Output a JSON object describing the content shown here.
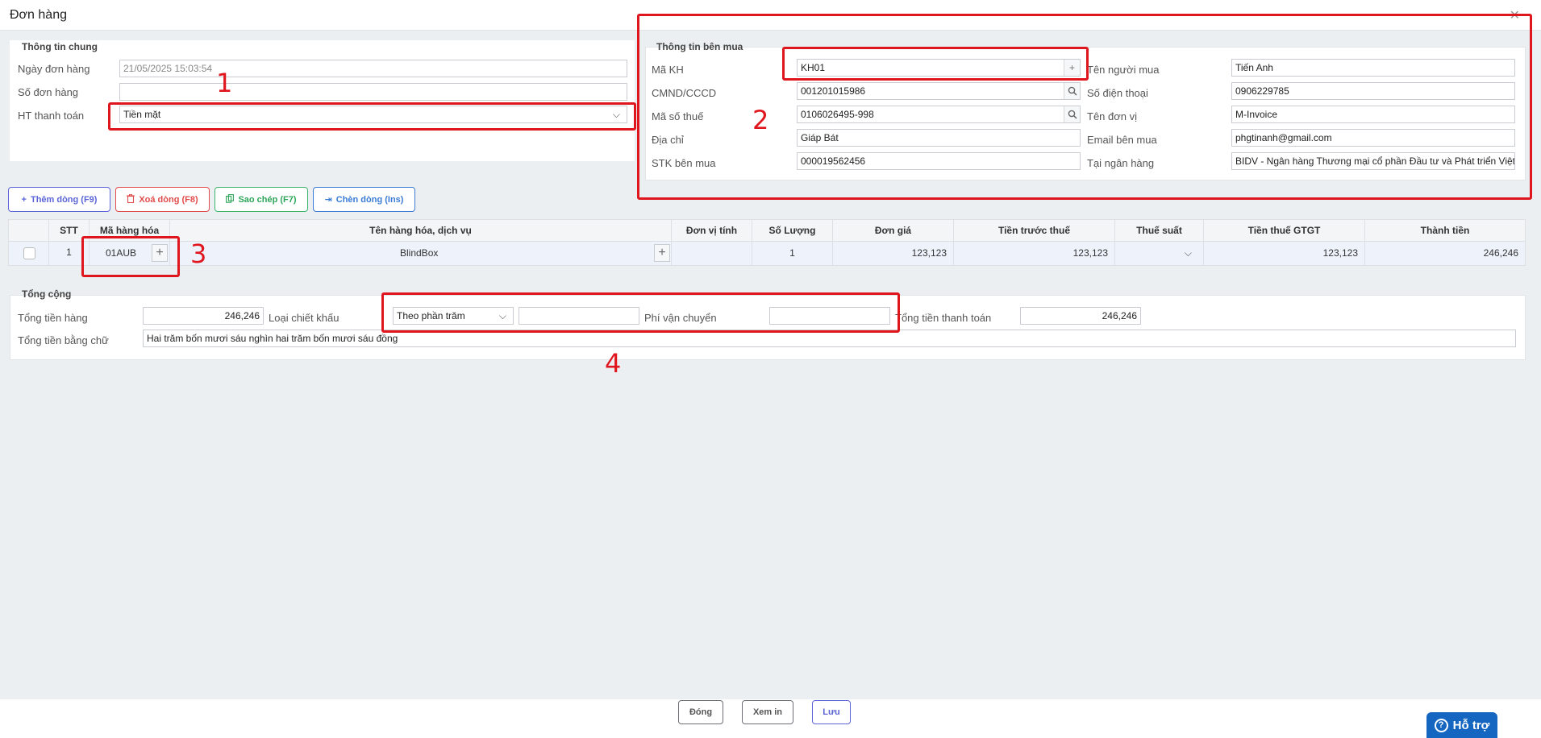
{
  "window": {
    "title": "Đơn hàng",
    "close_icon": "close-icon"
  },
  "general": {
    "title": "Thông tin chung",
    "order_date_label": "Ngày đơn hàng",
    "order_date_value": "21/05/2025 15:03:54",
    "order_no_label": "Số đơn hàng",
    "order_no_value": "",
    "payment_label": "HT thanh toán",
    "payment_value": "Tiền mặt"
  },
  "buyer": {
    "title": "Thông tin bên mua",
    "customer_code_label": "Mã KH",
    "customer_code_value": "KH01",
    "id_label": "CMND/CCCD",
    "id_value": "001201015986",
    "tax_label": "Mã số thuế",
    "tax_value": "0106026495-998",
    "address_label": "Địa chỉ",
    "address_value": "Giáp Bát",
    "account_label": "STK bên mua",
    "account_value": "000019562456",
    "buyer_name_label": "Tên người mua",
    "buyer_name_value": "Tiến Anh",
    "phone_label": "Số điện thoại",
    "phone_value": "0906229785",
    "unit_label": "Tên đơn vị",
    "unit_value": "M-Invoice",
    "email_label": "Email bên mua",
    "email_value": "phgtinanh@gmail.com",
    "bank_label": "Tại ngân hàng",
    "bank_value": "BIDV - Ngân hàng Thương mại cổ phần Đầu tư và Phát triển Việt Nam"
  },
  "toolbar": {
    "add_row": "Thêm dòng (F9)",
    "delete_row": "Xoá dòng (F8)",
    "copy": "Sao chép (F7)",
    "insert_row": "Chèn dòng (Ins)"
  },
  "table": {
    "columns": [
      "STT",
      "Mã hàng hóa",
      "Tên hàng hóa, dịch vụ",
      "Đơn vị tính",
      "Số Lượng",
      "Đơn giá",
      "Tiền trước thuế",
      "Thuế suất",
      "Tiền thuế GTGT",
      "Thành tiền"
    ],
    "rows": [
      {
        "stt": "1",
        "code": "01AUB",
        "name": "BlindBox",
        "unit": "",
        "qty": "1",
        "price": "123,123",
        "pre_tax": "123,123",
        "tax_rate": "",
        "vat": "123,123",
        "total": "246,246"
      }
    ]
  },
  "totals": {
    "title": "Tổng cộng",
    "goods_total_label": "Tổng tiền hàng",
    "goods_total_value": "246,246",
    "discount_type_label": "Loại chiết khấu",
    "discount_type_value": "Theo phần trăm",
    "discount_value": "",
    "shipping_label": "Phí vận chuyển",
    "shipping_value": "",
    "payment_total_label": "Tổng tiền thanh toán",
    "payment_total_value": "246,246",
    "in_words_label": "Tổng tiền bằng chữ",
    "in_words_value": "Hai trăm bốn mươi sáu nghìn hai trăm bốn mươi sáu đồng"
  },
  "annotations": [
    "1",
    "2",
    "3",
    "4"
  ],
  "footer": {
    "close": "Đóng",
    "print_preview": "Xem in",
    "save": "Lưu",
    "help": "Hỗ trợ"
  }
}
